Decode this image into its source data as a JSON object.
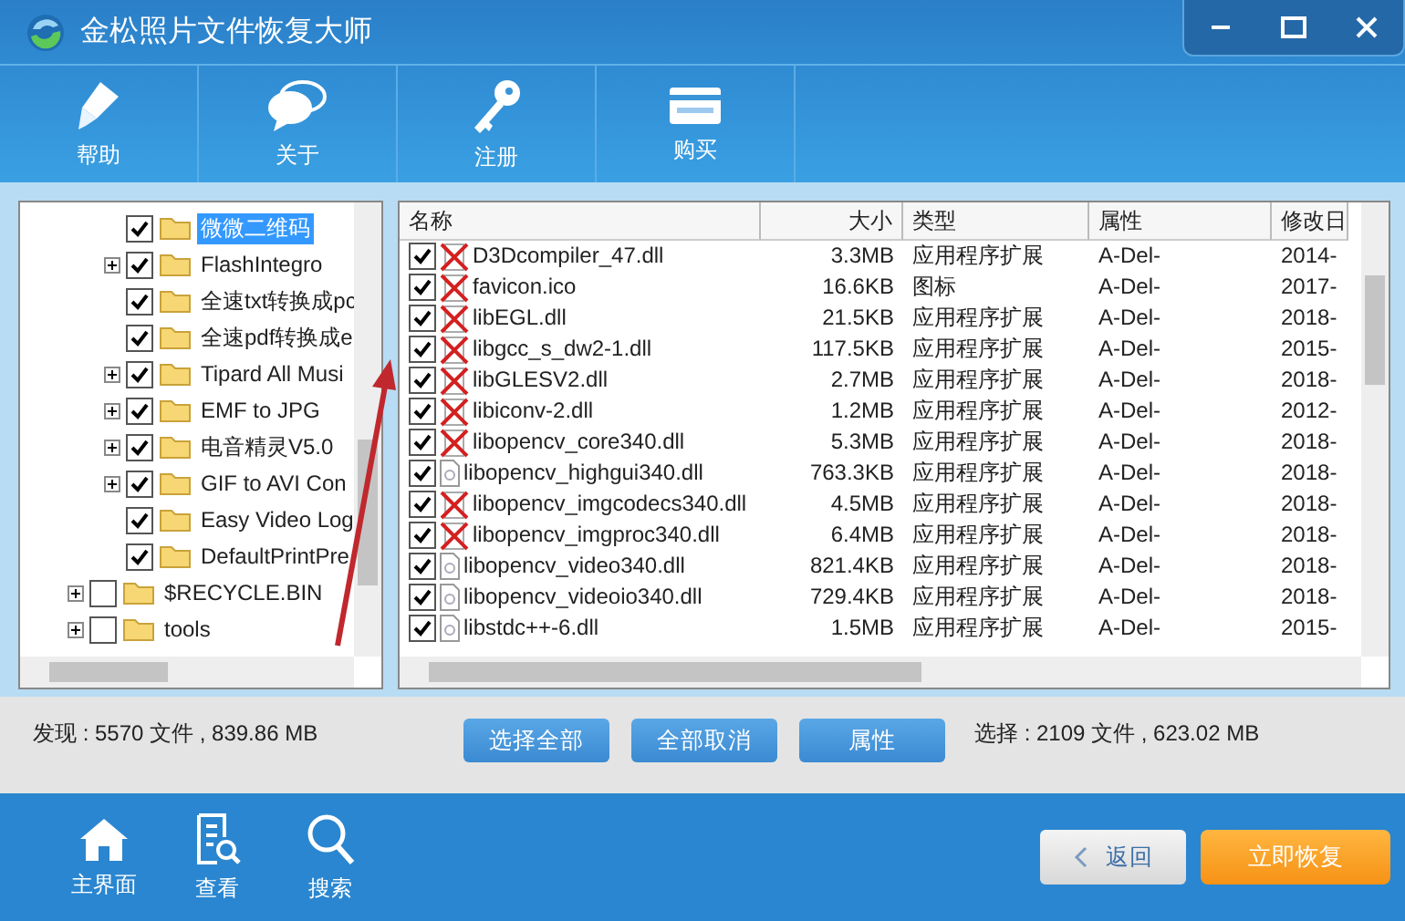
{
  "window": {
    "title": "金松照片文件恢复大师"
  },
  "toolbar": [
    {
      "label": "帮助",
      "kind": "pen"
    },
    {
      "label": "关于",
      "kind": "chat"
    },
    {
      "label": "注册",
      "kind": "key"
    },
    {
      "label": "购买",
      "kind": "card"
    }
  ],
  "tree": {
    "items": [
      {
        "children": [
          {
            "label": "微微二维码",
            "expandable": false,
            "checked": true,
            "selected": true
          },
          {
            "label": "FlashIntegro",
            "expandable": true,
            "checked": true,
            "selected": false
          },
          {
            "label": "全速txt转换成pc",
            "expandable": false,
            "checked": true,
            "selected": false
          },
          {
            "label": "全速pdf转换成e",
            "expandable": false,
            "checked": true,
            "selected": false
          },
          {
            "label": "Tipard All Musi",
            "expandable": true,
            "checked": true,
            "selected": false
          },
          {
            "label": "EMF to JPG",
            "expandable": true,
            "checked": true,
            "selected": false
          },
          {
            "label": "电音精灵V5.0",
            "expandable": true,
            "checked": true,
            "selected": false
          },
          {
            "label": "GIF to AVI Con",
            "expandable": true,
            "checked": true,
            "selected": false
          },
          {
            "label": "Easy Video Log",
            "expandable": false,
            "checked": true,
            "selected": false
          },
          {
            "label": "DefaultPrintPre",
            "expandable": false,
            "checked": true,
            "selected": false
          }
        ]
      },
      {
        "label": "$RECYCLE.BIN",
        "expandable": true,
        "checked": false,
        "selected": false
      },
      {
        "label": "tools",
        "expandable": true,
        "checked": false,
        "selected": false
      }
    ]
  },
  "table": {
    "columns": [
      "名称",
      "大小",
      "类型",
      "属性",
      "修改日"
    ],
    "rows": [
      {
        "kind": "deleted",
        "checked": true,
        "cells": [
          "D3Dcompiler_47.dll",
          "3.3MB",
          "应用程序扩展",
          "A-Del-",
          "2014-"
        ]
      },
      {
        "kind": "deleted",
        "checked": true,
        "cells": [
          "favicon.ico",
          "16.6KB",
          "图标",
          "A-Del-",
          "2017-"
        ]
      },
      {
        "kind": "deleted",
        "checked": true,
        "cells": [
          "libEGL.dll",
          "21.5KB",
          "应用程序扩展",
          "A-Del-",
          "2018-"
        ]
      },
      {
        "kind": "deleted",
        "checked": true,
        "cells": [
          "libgcc_s_dw2-1.dll",
          "117.5KB",
          "应用程序扩展",
          "A-Del-",
          "2015-"
        ]
      },
      {
        "kind": "deleted",
        "checked": true,
        "cells": [
          "libGLESV2.dll",
          "2.7MB",
          "应用程序扩展",
          "A-Del-",
          "2018-"
        ]
      },
      {
        "kind": "deleted",
        "checked": true,
        "cells": [
          "libiconv-2.dll",
          "1.2MB",
          "应用程序扩展",
          "A-Del-",
          "2012-"
        ]
      },
      {
        "kind": "deleted",
        "checked": true,
        "cells": [
          "libopencv_core340.dll",
          "5.3MB",
          "应用程序扩展",
          "A-Del-",
          "2018-"
        ]
      },
      {
        "kind": "file",
        "checked": true,
        "cells": [
          "libopencv_highgui340.dll",
          "763.3KB",
          "应用程序扩展",
          "A-Del-",
          "2018-"
        ]
      },
      {
        "kind": "deleted",
        "checked": true,
        "cells": [
          "libopencv_imgcodecs340.dll",
          "4.5MB",
          "应用程序扩展",
          "A-Del-",
          "2018-"
        ]
      },
      {
        "kind": "deleted",
        "checked": true,
        "cells": [
          "libopencv_imgproc340.dll",
          "6.4MB",
          "应用程序扩展",
          "A-Del-",
          "2018-"
        ]
      },
      {
        "kind": "file",
        "checked": true,
        "cells": [
          "libopencv_video340.dll",
          "821.4KB",
          "应用程序扩展",
          "A-Del-",
          "2018-"
        ]
      },
      {
        "kind": "file",
        "checked": true,
        "cells": [
          "libopencv_videoio340.dll",
          "729.4KB",
          "应用程序扩展",
          "A-Del-",
          "2018-"
        ]
      },
      {
        "kind": "file",
        "checked": true,
        "cells": [
          "libstdc++-6.dll",
          "1.5MB",
          "应用程序扩展",
          "A-Del-",
          "2015-"
        ]
      }
    ]
  },
  "status": {
    "found": "发现 : 5570 文件 , 839.86 MB",
    "selected": "选择 : 2109 文件 , 623.02 MB",
    "buttons": [
      "选择全部",
      "全部取消",
      "属性"
    ]
  },
  "footer": {
    "nav": [
      {
        "label": "主界面",
        "kind": "home"
      },
      {
        "label": "查看",
        "kind": "view"
      },
      {
        "label": "搜索",
        "kind": "search"
      }
    ],
    "back": "返回",
    "recover": "立即恢复"
  }
}
